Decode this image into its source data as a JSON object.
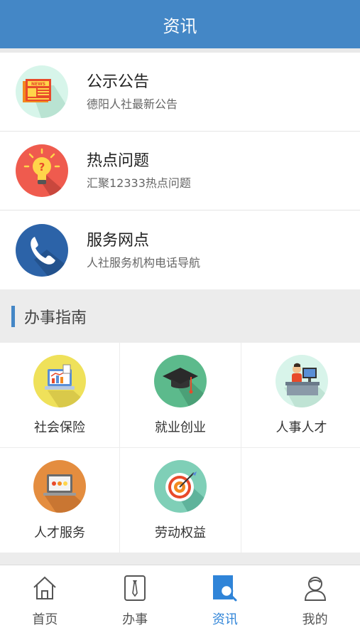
{
  "header": {
    "title": "资讯"
  },
  "news": [
    {
      "title": "公示公告",
      "subtitle": "德阳人社最新公告",
      "icon": "news-icon",
      "icon_text": "NEWS"
    },
    {
      "title": "热点问题",
      "subtitle": "汇聚12333热点问题",
      "icon": "lightbulb-icon"
    },
    {
      "title": "服务网点",
      "subtitle": "人社服务机构电话导航",
      "icon": "phone-icon"
    }
  ],
  "guide": {
    "title": "办事指南",
    "items": [
      {
        "label": "社会保险",
        "icon": "laptop-chart-icon"
      },
      {
        "label": "就业创业",
        "icon": "graduation-cap-icon"
      },
      {
        "label": "人事人才",
        "icon": "office-worker-icon"
      },
      {
        "label": "人才服务",
        "icon": "laptop-icon"
      },
      {
        "label": "劳动权益",
        "icon": "target-icon"
      }
    ]
  },
  "tabbar": {
    "items": [
      {
        "label": "首页",
        "icon": "home-icon",
        "active": false
      },
      {
        "label": "办事",
        "icon": "tie-icon",
        "active": false
      },
      {
        "label": "资讯",
        "icon": "news-search-icon",
        "active": true
      },
      {
        "label": "我的",
        "icon": "user-icon",
        "active": false
      }
    ]
  },
  "colors": {
    "brand": "#4487c6",
    "active_tab": "#2f84d8"
  }
}
